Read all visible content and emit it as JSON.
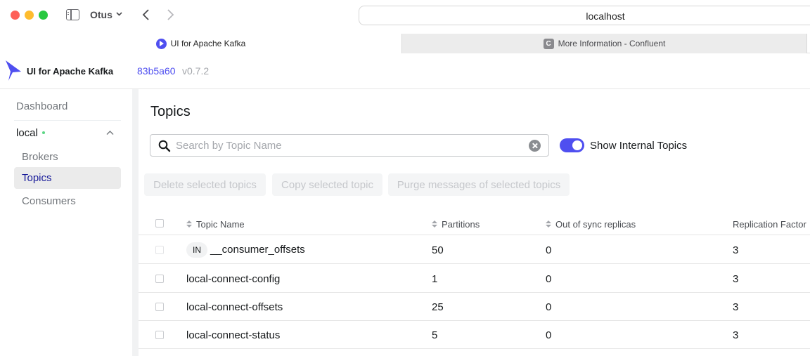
{
  "browser": {
    "profile_name": "Otus",
    "url": "localhost",
    "tabs": [
      {
        "label": "UI for Apache Kafka",
        "active": true
      },
      {
        "label": "More Information - Confluent",
        "favicon_letter": "C",
        "active": false
      }
    ]
  },
  "header": {
    "brand": "UI for Apache Kafka",
    "commit": "83b5a60",
    "version": "v0.7.2"
  },
  "sidebar": {
    "dashboard": "Dashboard",
    "cluster": {
      "name": "local",
      "status": "online",
      "status_color": "#5cd685"
    },
    "items": [
      {
        "label": "Brokers",
        "active": false
      },
      {
        "label": "Topics",
        "active": true
      },
      {
        "label": "Consumers",
        "active": false
      }
    ]
  },
  "main": {
    "title": "Topics",
    "search": {
      "placeholder": "Search by Topic Name",
      "value": ""
    },
    "show_internal": {
      "label": "Show Internal Topics",
      "enabled": true
    },
    "actions": {
      "delete": "Delete selected topics",
      "copy": "Copy selected topic",
      "purge": "Purge messages of selected topics"
    },
    "table": {
      "columns": [
        "Topic Name",
        "Partitions",
        "Out of sync replicas",
        "Replication Factor"
      ],
      "rows": [
        {
          "badge": "IN",
          "name": "__consumer_offsets",
          "partitions": "50",
          "out_of_sync": "0",
          "replication": "3"
        },
        {
          "badge": "",
          "name": "local-connect-config",
          "partitions": "1",
          "out_of_sync": "0",
          "replication": "3"
        },
        {
          "badge": "",
          "name": "local-connect-offsets",
          "partitions": "25",
          "out_of_sync": "0",
          "replication": "3"
        },
        {
          "badge": "",
          "name": "local-connect-status",
          "partitions": "5",
          "out_of_sync": "0",
          "replication": "3"
        }
      ]
    }
  },
  "colors": {
    "accent": "#4f4ff0",
    "muted_text": "#73777c"
  }
}
